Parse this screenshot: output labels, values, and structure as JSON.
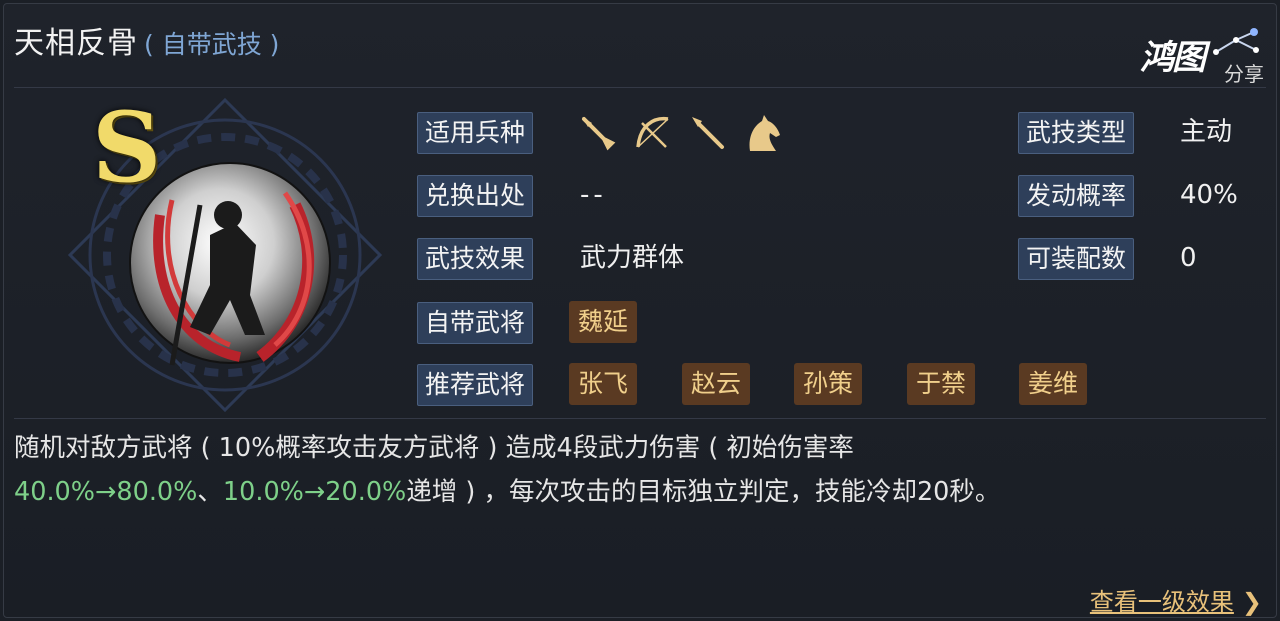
{
  "skill": {
    "name": "天相反骨",
    "tag": "( 自带武技 )",
    "grade": "S"
  },
  "logo": {
    "main": "鸿图",
    "sub": "分享"
  },
  "rows": {
    "troops": {
      "label": "适用兵种",
      "icons": [
        "sword-icon",
        "bow-icon",
        "spear-icon",
        "horse-icon"
      ]
    },
    "exchange": {
      "label": "兑换出处",
      "value": "--"
    },
    "effect": {
      "label": "武技效果",
      "value": "武力群体"
    },
    "own_general": {
      "label": "自带武将",
      "value": "魏延"
    },
    "recommended": {
      "label": "推荐武将",
      "values": [
        "张飞",
        "赵云",
        "孙策",
        "于禁",
        "姜维"
      ]
    },
    "type": {
      "label": "武技类型",
      "value": "主动"
    },
    "chance": {
      "label": "发动概率",
      "value": "40%"
    },
    "slots": {
      "label": "可装配数",
      "value": "0"
    }
  },
  "description": {
    "line1": "随机对敌方武将 ( 10%概率攻击友方武将 ) 造成4段武力伤害 ( 初始伤害率",
    "hl1": "40.0%→80.0%",
    "sep": "、",
    "hl2": "10.0%→20.0%",
    "rest": "递增 ) ，每次攻击的目标独立判定，技能冷却20秒。"
  },
  "footer": {
    "link": "查看一级效果",
    "chevron": "❯"
  },
  "colors": {
    "accent_gold": "#e8c17a",
    "label_bg": "#2e3f5a",
    "tag_bg": "#5a3a22",
    "highlight_green": "#7ed089",
    "grade_yellow": "#f1da6a"
  }
}
